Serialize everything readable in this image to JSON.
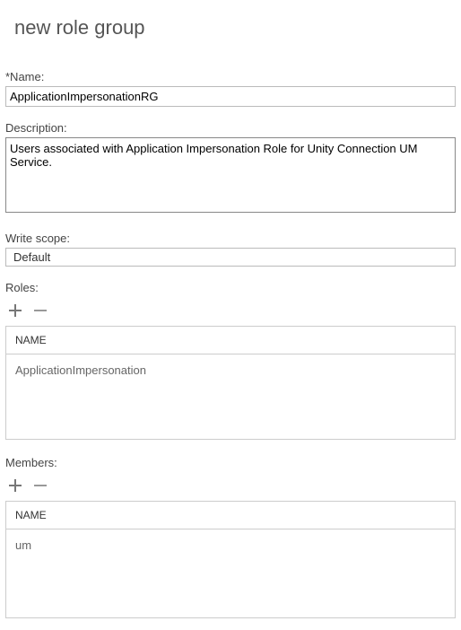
{
  "pageTitle": "new role group",
  "nameField": {
    "label": "*Name:",
    "value": "ApplicationImpersonationRG"
  },
  "descriptionField": {
    "label": "Description:",
    "value": "Users associated with Application Impersonation Role for Unity Connection UM Service."
  },
  "writeScopeField": {
    "label": "Write scope:",
    "value": "Default"
  },
  "rolesSection": {
    "label": "Roles:",
    "columnHeader": "NAME",
    "items": [
      "ApplicationImpersonation"
    ]
  },
  "membersSection": {
    "label": "Members:",
    "columnHeader": "NAME",
    "items": [
      "um"
    ]
  }
}
